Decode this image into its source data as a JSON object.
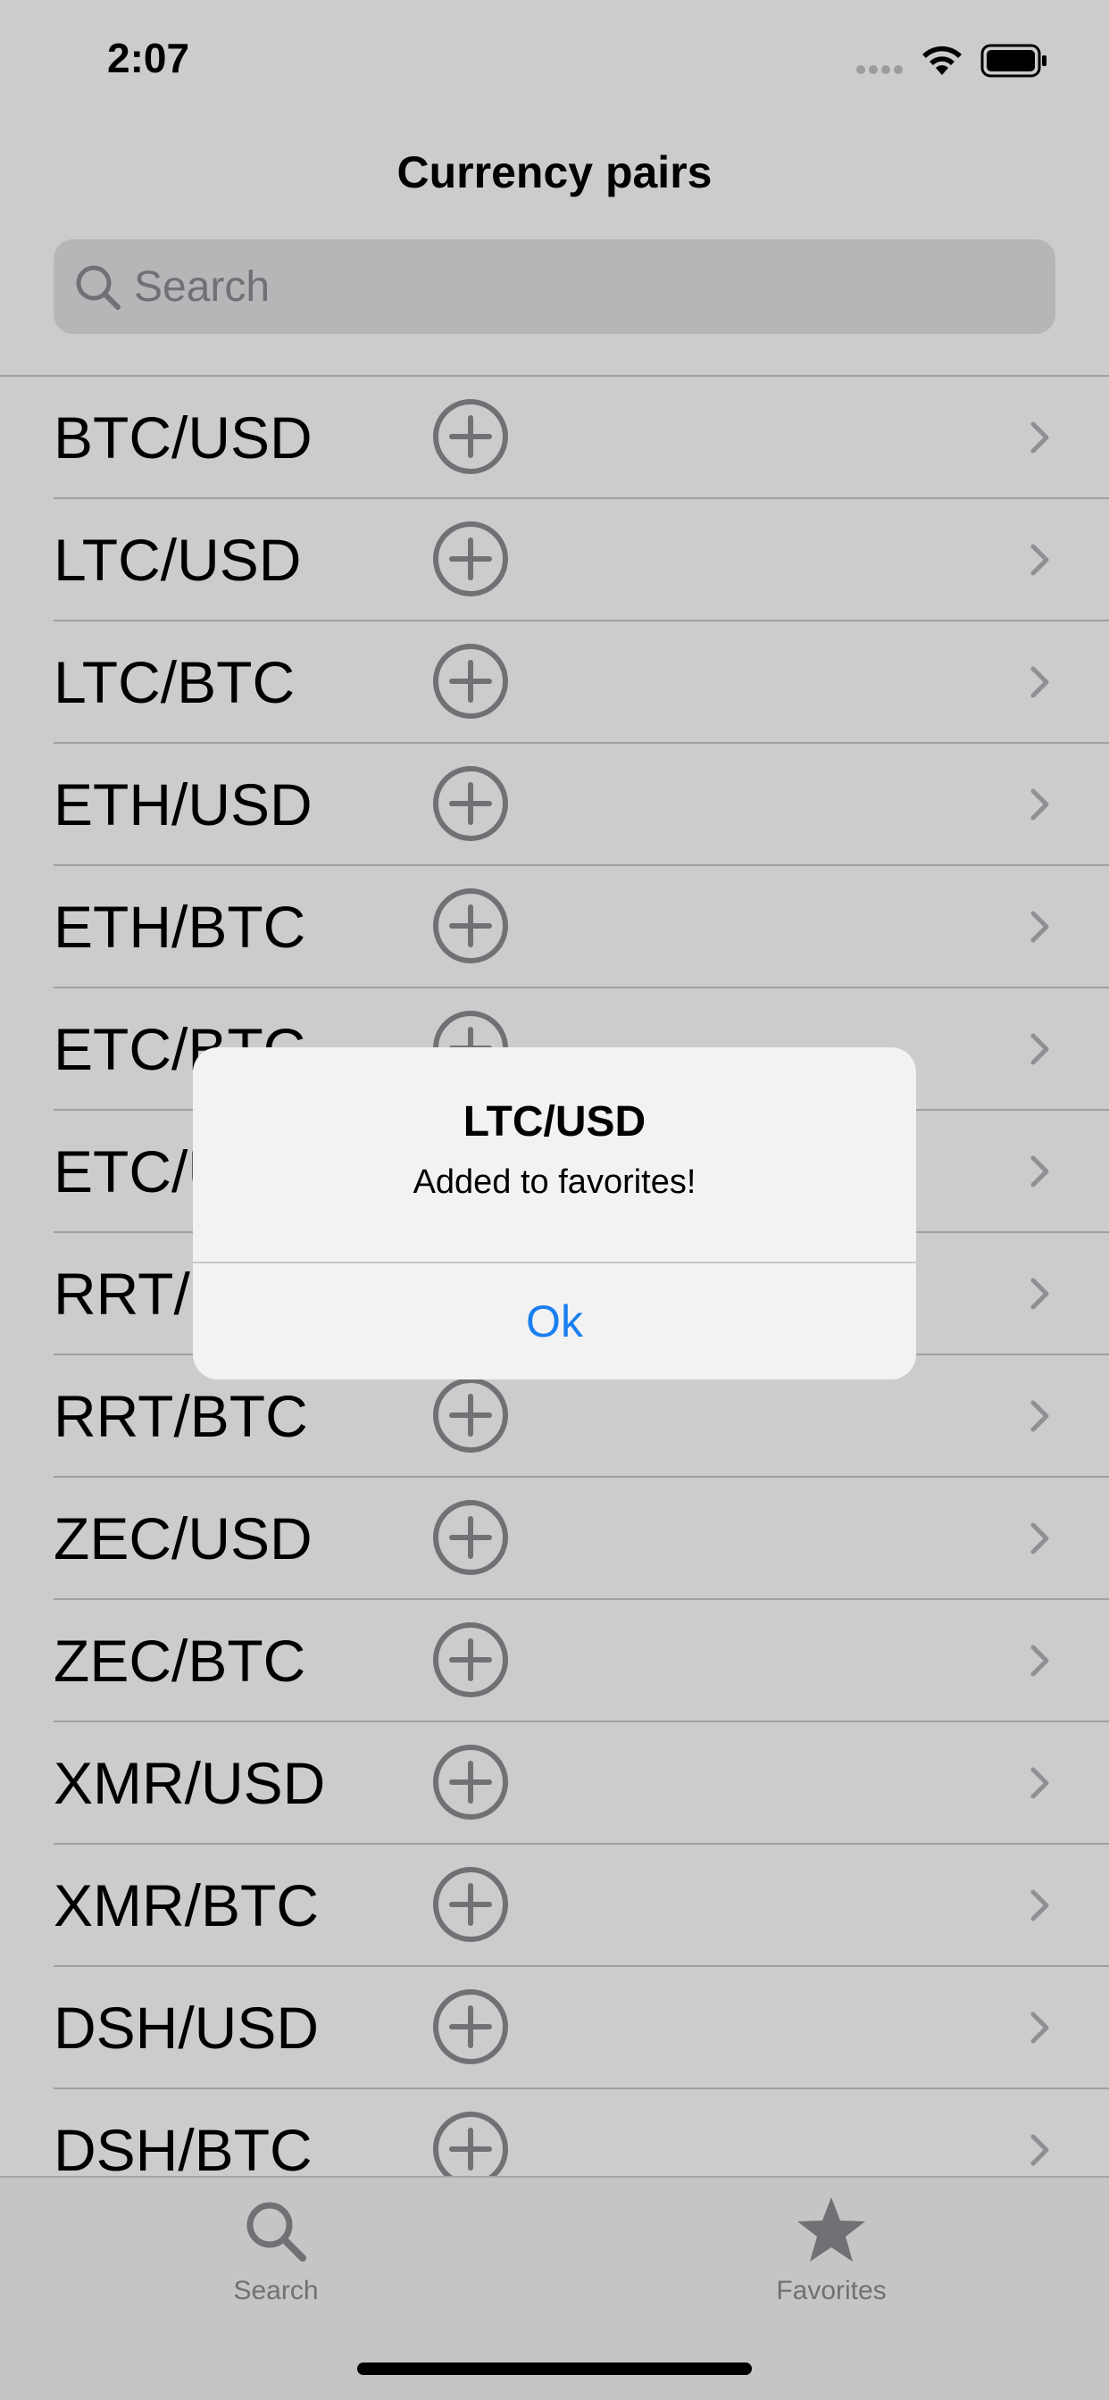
{
  "status_bar": {
    "time": "2:07"
  },
  "nav": {
    "title": "Currency pairs"
  },
  "search": {
    "placeholder": "Search"
  },
  "pairs": [
    {
      "label": "BTC/USD"
    },
    {
      "label": "LTC/USD"
    },
    {
      "label": "LTC/BTC"
    },
    {
      "label": "ETH/USD"
    },
    {
      "label": "ETH/BTC"
    },
    {
      "label": "ETC/BTC"
    },
    {
      "label": "ETC/USD"
    },
    {
      "label": "RRT/USD"
    },
    {
      "label": "RRT/BTC"
    },
    {
      "label": "ZEC/USD"
    },
    {
      "label": "ZEC/BTC"
    },
    {
      "label": "XMR/USD"
    },
    {
      "label": "XMR/BTC"
    },
    {
      "label": "DSH/USD"
    },
    {
      "label": "DSH/BTC"
    }
  ],
  "row_icons": {
    "add": "plus-circle-icon",
    "disclosure": "chevron-right-icon"
  },
  "tab_bar": {
    "tabs": [
      {
        "label": "Search",
        "icon": "magnifying-glass-icon"
      },
      {
        "label": "Favorites",
        "icon": "star-icon"
      }
    ]
  },
  "alert": {
    "title": "LTC/USD",
    "message": "Added to favorites!",
    "button": "Ok"
  },
  "colors": {
    "accent": "#1a7ff0",
    "icon_gray": "#8e8e93",
    "overlay": "rgba(0,0,0,0.2)"
  }
}
